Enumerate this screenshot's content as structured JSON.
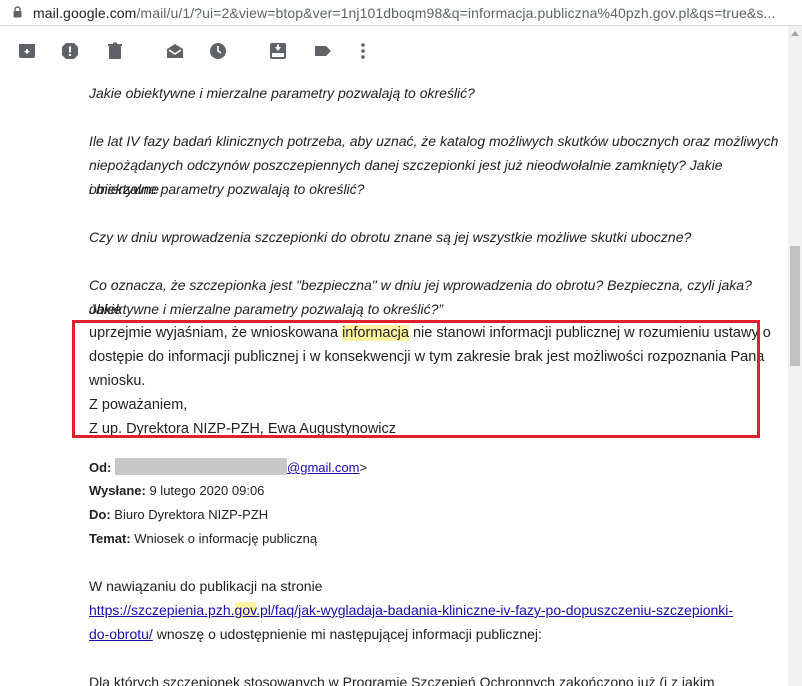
{
  "browser": {
    "url_host": "mail.google.com",
    "url_rest": "/mail/u/1/?ui=2&view=btop&ver=1nj101dboqm98&q=informacja.publiczna%40pzh.gov.pl&qs=true&s..."
  },
  "toolbar": {
    "icons": [
      "archive-icon",
      "report-spam-icon",
      "delete-icon",
      "mark-unread-icon",
      "snooze-icon",
      "move-to-icon",
      "label-icon",
      "more-icon"
    ]
  },
  "quoted": {
    "line1": "Jakie obiektywne i mierzalne parametry pozwalają to określić?",
    "para2_l1": "Ile lat IV fazy badań klinicznych potrzeba, aby uznać, że katalog możliwych skutków ubocznych oraz możliwych",
    "para2_l2": "niepożądanych odczynów poszczepiennych danej szczepionki jest już nieodwołalnie zamknięty? Jakie obiektywne",
    "para2_l3": "i mierzalne parametry pozwalają to określić?",
    "para3": "Czy w dniu wprowadzenia szczepionki do obrotu znane są jej wszystkie możliwe skutki uboczne?",
    "para4_l1": "Co oznacza, że szczepionka jest \"bezpieczna\" w dniu jej wprowadzenia do obrotu? Bezpieczna, czyli jaka? Jakie",
    "para4_l2": "obiektywne i mierzalne parametry pozwalają to określić?”"
  },
  "reply": {
    "l1_a": "uprzejmie wyjaśniam, że wnioskowana ",
    "l1_hl": "informacja",
    "l1_b": " nie stanowi informacji publicznej w rozumieniu ustawy o",
    "l2": "dostępie do informacji publicznej i w konsekwencji w tym zakresie brak jest możliwości rozpoznania Pana",
    "l3": "wniosku.",
    "l4": "Z poważaniem,",
    "l5": "Z up. Dyrektora NIZP-PZH, Ewa Augustynowicz"
  },
  "headers": {
    "from_label": "Od:",
    "from_domain": "@gmail.com",
    "from_suffix": ">",
    "sent_label": "Wysłane:",
    "sent_value": "9 lutego 2020 09:06",
    "to_label": "Do:",
    "to_value": "Biuro Dyrektora NIZP-PZH",
    "subject_label": "Temat:",
    "subject_value": "Wniosek o informację publiczną"
  },
  "message": {
    "intro": "W nawiązaniu do publikacji na stronie",
    "link_a": "https://szczepienia.pzh.",
    "link_hl": "gov",
    "link_b": ".pl/faq/jak-wygladaja-badania-kliniczne-iv-fazy-po-dopuszczeniu-szczepionki-",
    "link_c": "do-obrotu/",
    "after_link": " wnoszę o udostępnienie mi następującej informacji publicznej:",
    "cut_line": "Dla których szczepionek stosowanych w Programie Szczepień Ochronnych zakończono już (i z jakim"
  }
}
